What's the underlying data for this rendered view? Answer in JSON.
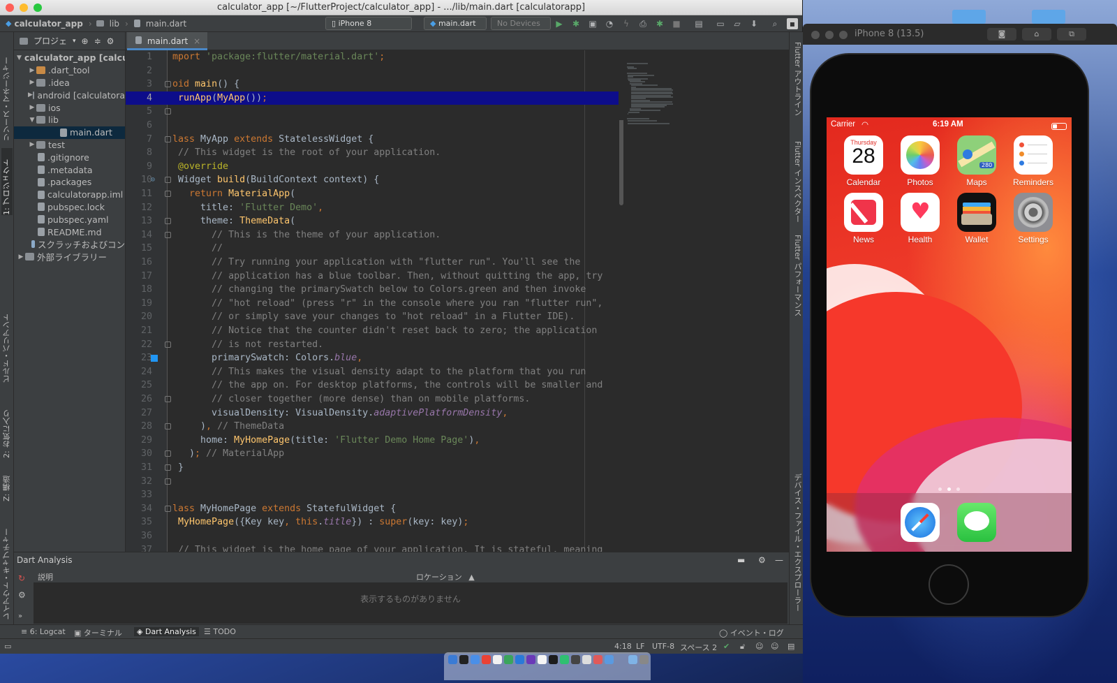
{
  "window": {
    "title": "calculator_app [~/FlutterProject/calculator_app] - .../lib/main.dart [calculatorapp]"
  },
  "navbar": {
    "crumbs": [
      "calculator_app",
      "lib",
      "main.dart"
    ],
    "device_select": "iPhone 8 (mobile)",
    "run_config": "main.dart",
    "devices": "No Devices"
  },
  "left_tabs": [
    "リソース・マネージャー",
    "1: プロジェクト",
    "ビルド・バリアント",
    "2: お気に入り",
    "Z: 構造",
    "レイアウト・キャプチャー"
  ],
  "right_tabs": [
    "Flutter アウトライン",
    "Flutter インスペクター",
    "Flutter パフォーマンス",
    "デバイス・ファイル・エクスプローラー"
  ],
  "project": {
    "header": "プロジェ",
    "items": [
      {
        "label": "calculator_app [calcula",
        "kind": "root"
      },
      {
        "label": ".dart_tool",
        "kind": "folder-orange"
      },
      {
        "label": ".idea",
        "kind": "folder"
      },
      {
        "label": "android [calculatora",
        "kind": "folder"
      },
      {
        "label": "ios",
        "kind": "folder"
      },
      {
        "label": "lib",
        "kind": "folder-open"
      },
      {
        "label": "main.dart",
        "kind": "file-selected"
      },
      {
        "label": "test",
        "kind": "folder"
      },
      {
        "label": ".gitignore",
        "kind": "file"
      },
      {
        "label": ".metadata",
        "kind": "file"
      },
      {
        "label": ".packages",
        "kind": "file"
      },
      {
        "label": "calculatorapp.iml",
        "kind": "file"
      },
      {
        "label": "pubspec.lock",
        "kind": "file"
      },
      {
        "label": "pubspec.yaml",
        "kind": "file"
      },
      {
        "label": "README.md",
        "kind": "file"
      },
      {
        "label": "スクラッチおよびコン",
        "kind": "scratch"
      },
      {
        "label": "外部ライブラリー",
        "kind": "lib"
      }
    ]
  },
  "editor": {
    "tab": "main.dart",
    "current_line": 4,
    "lines": [
      {
        "n": "1",
        "code": "mport 'package:flutter/material.dart';"
      },
      {
        "n": "2",
        "code": ""
      },
      {
        "n": "3",
        "code": "oid main() {"
      },
      {
        "n": "4",
        "code": " runApp(MyApp());"
      },
      {
        "n": "5",
        "code": ""
      },
      {
        "n": "6",
        "code": ""
      },
      {
        "n": "7",
        "code": "lass MyApp extends StatelessWidget {"
      },
      {
        "n": "8",
        "code": " // This widget is the root of your application."
      },
      {
        "n": "9",
        "code": " @override"
      },
      {
        "n": "10",
        "code": " Widget build(BuildContext context) {"
      },
      {
        "n": "11",
        "code": "   return MaterialApp("
      },
      {
        "n": "12",
        "code": "     title: 'Flutter Demo',"
      },
      {
        "n": "13",
        "code": "     theme: ThemeData("
      },
      {
        "n": "14",
        "code": "       // This is the theme of your application."
      },
      {
        "n": "15",
        "code": "       //"
      },
      {
        "n": "16",
        "code": "       // Try running your application with \"flutter run\". You'll see the"
      },
      {
        "n": "17",
        "code": "       // application has a blue toolbar. Then, without quitting the app, try"
      },
      {
        "n": "18",
        "code": "       // changing the primarySwatch below to Colors.green and then invoke"
      },
      {
        "n": "19",
        "code": "       // \"hot reload\" (press \"r\" in the console where you ran \"flutter run\","
      },
      {
        "n": "20",
        "code": "       // or simply save your changes to \"hot reload\" in a Flutter IDE)."
      },
      {
        "n": "21",
        "code": "       // Notice that the counter didn't reset back to zero; the application"
      },
      {
        "n": "22",
        "code": "       // is not restarted."
      },
      {
        "n": "23",
        "code": "       primarySwatch: Colors.blue,"
      },
      {
        "n": "24",
        "code": "       // This makes the visual density adapt to the platform that you run"
      },
      {
        "n": "25",
        "code": "       // the app on. For desktop platforms, the controls will be smaller and"
      },
      {
        "n": "26",
        "code": "       // closer together (more dense) than on mobile platforms."
      },
      {
        "n": "27",
        "code": "       visualDensity: VisualDensity.adaptivePlatformDensity,"
      },
      {
        "n": "28",
        "code": "     ), // ThemeData"
      },
      {
        "n": "29",
        "code": "     home: MyHomePage(title: 'Flutter Demo Home Page'),"
      },
      {
        "n": "30",
        "code": "   ); // MaterialApp"
      },
      {
        "n": "31",
        "code": " }"
      },
      {
        "n": "32",
        "code": ""
      },
      {
        "n": "33",
        "code": ""
      },
      {
        "n": "34",
        "code": "lass MyHomePage extends StatefulWidget {"
      },
      {
        "n": "35",
        "code": " MyHomePage({Key key, this.title}) : super(key: key);"
      },
      {
        "n": "36",
        "code": ""
      },
      {
        "n": "37",
        "code": " // This widget is the home page of your application. It is stateful, meaning"
      }
    ]
  },
  "dart_analysis": {
    "title": "Dart Analysis",
    "col_description": "説明",
    "col_location": "ロケーション",
    "empty": "表示するものがありません"
  },
  "toolwindows": {
    "logcat": "6: Logcat",
    "terminal": "ターミナル",
    "dart_analysis": "Dart Analysis",
    "todo": "TODO",
    "event_log": "イベント・ログ"
  },
  "status": {
    "position": "4:18",
    "line_sep": "LF",
    "encoding": "UTF-8",
    "indent": "スペース 2"
  },
  "simulator": {
    "title": "iPhone 8 (13.5)",
    "carrier": "Carrier",
    "time": "6:19 AM",
    "calendar_day": "Thursday",
    "calendar_date": "28",
    "maps_badge": "280",
    "apps": [
      {
        "label": "Calendar",
        "icon": "calendar-icon",
        "color": "#ffffff"
      },
      {
        "label": "Photos",
        "icon": "photos-icon",
        "color": "#ffffff"
      },
      {
        "label": "Maps",
        "icon": "maps-icon",
        "color": "#8ed07a"
      },
      {
        "label": "Reminders",
        "icon": "reminders-icon",
        "color": "#ffffff"
      },
      {
        "label": "News",
        "icon": "news-icon",
        "color": "#ffffff"
      },
      {
        "label": "Health",
        "icon": "health-icon",
        "color": "#ffffff"
      },
      {
        "label": "Wallet",
        "icon": "wallet-icon",
        "color": "#111111"
      },
      {
        "label": "Settings",
        "icon": "settings-icon",
        "color": "#8e8e93"
      }
    ],
    "dock_apps": [
      "safari-icon",
      "messages-icon"
    ]
  }
}
